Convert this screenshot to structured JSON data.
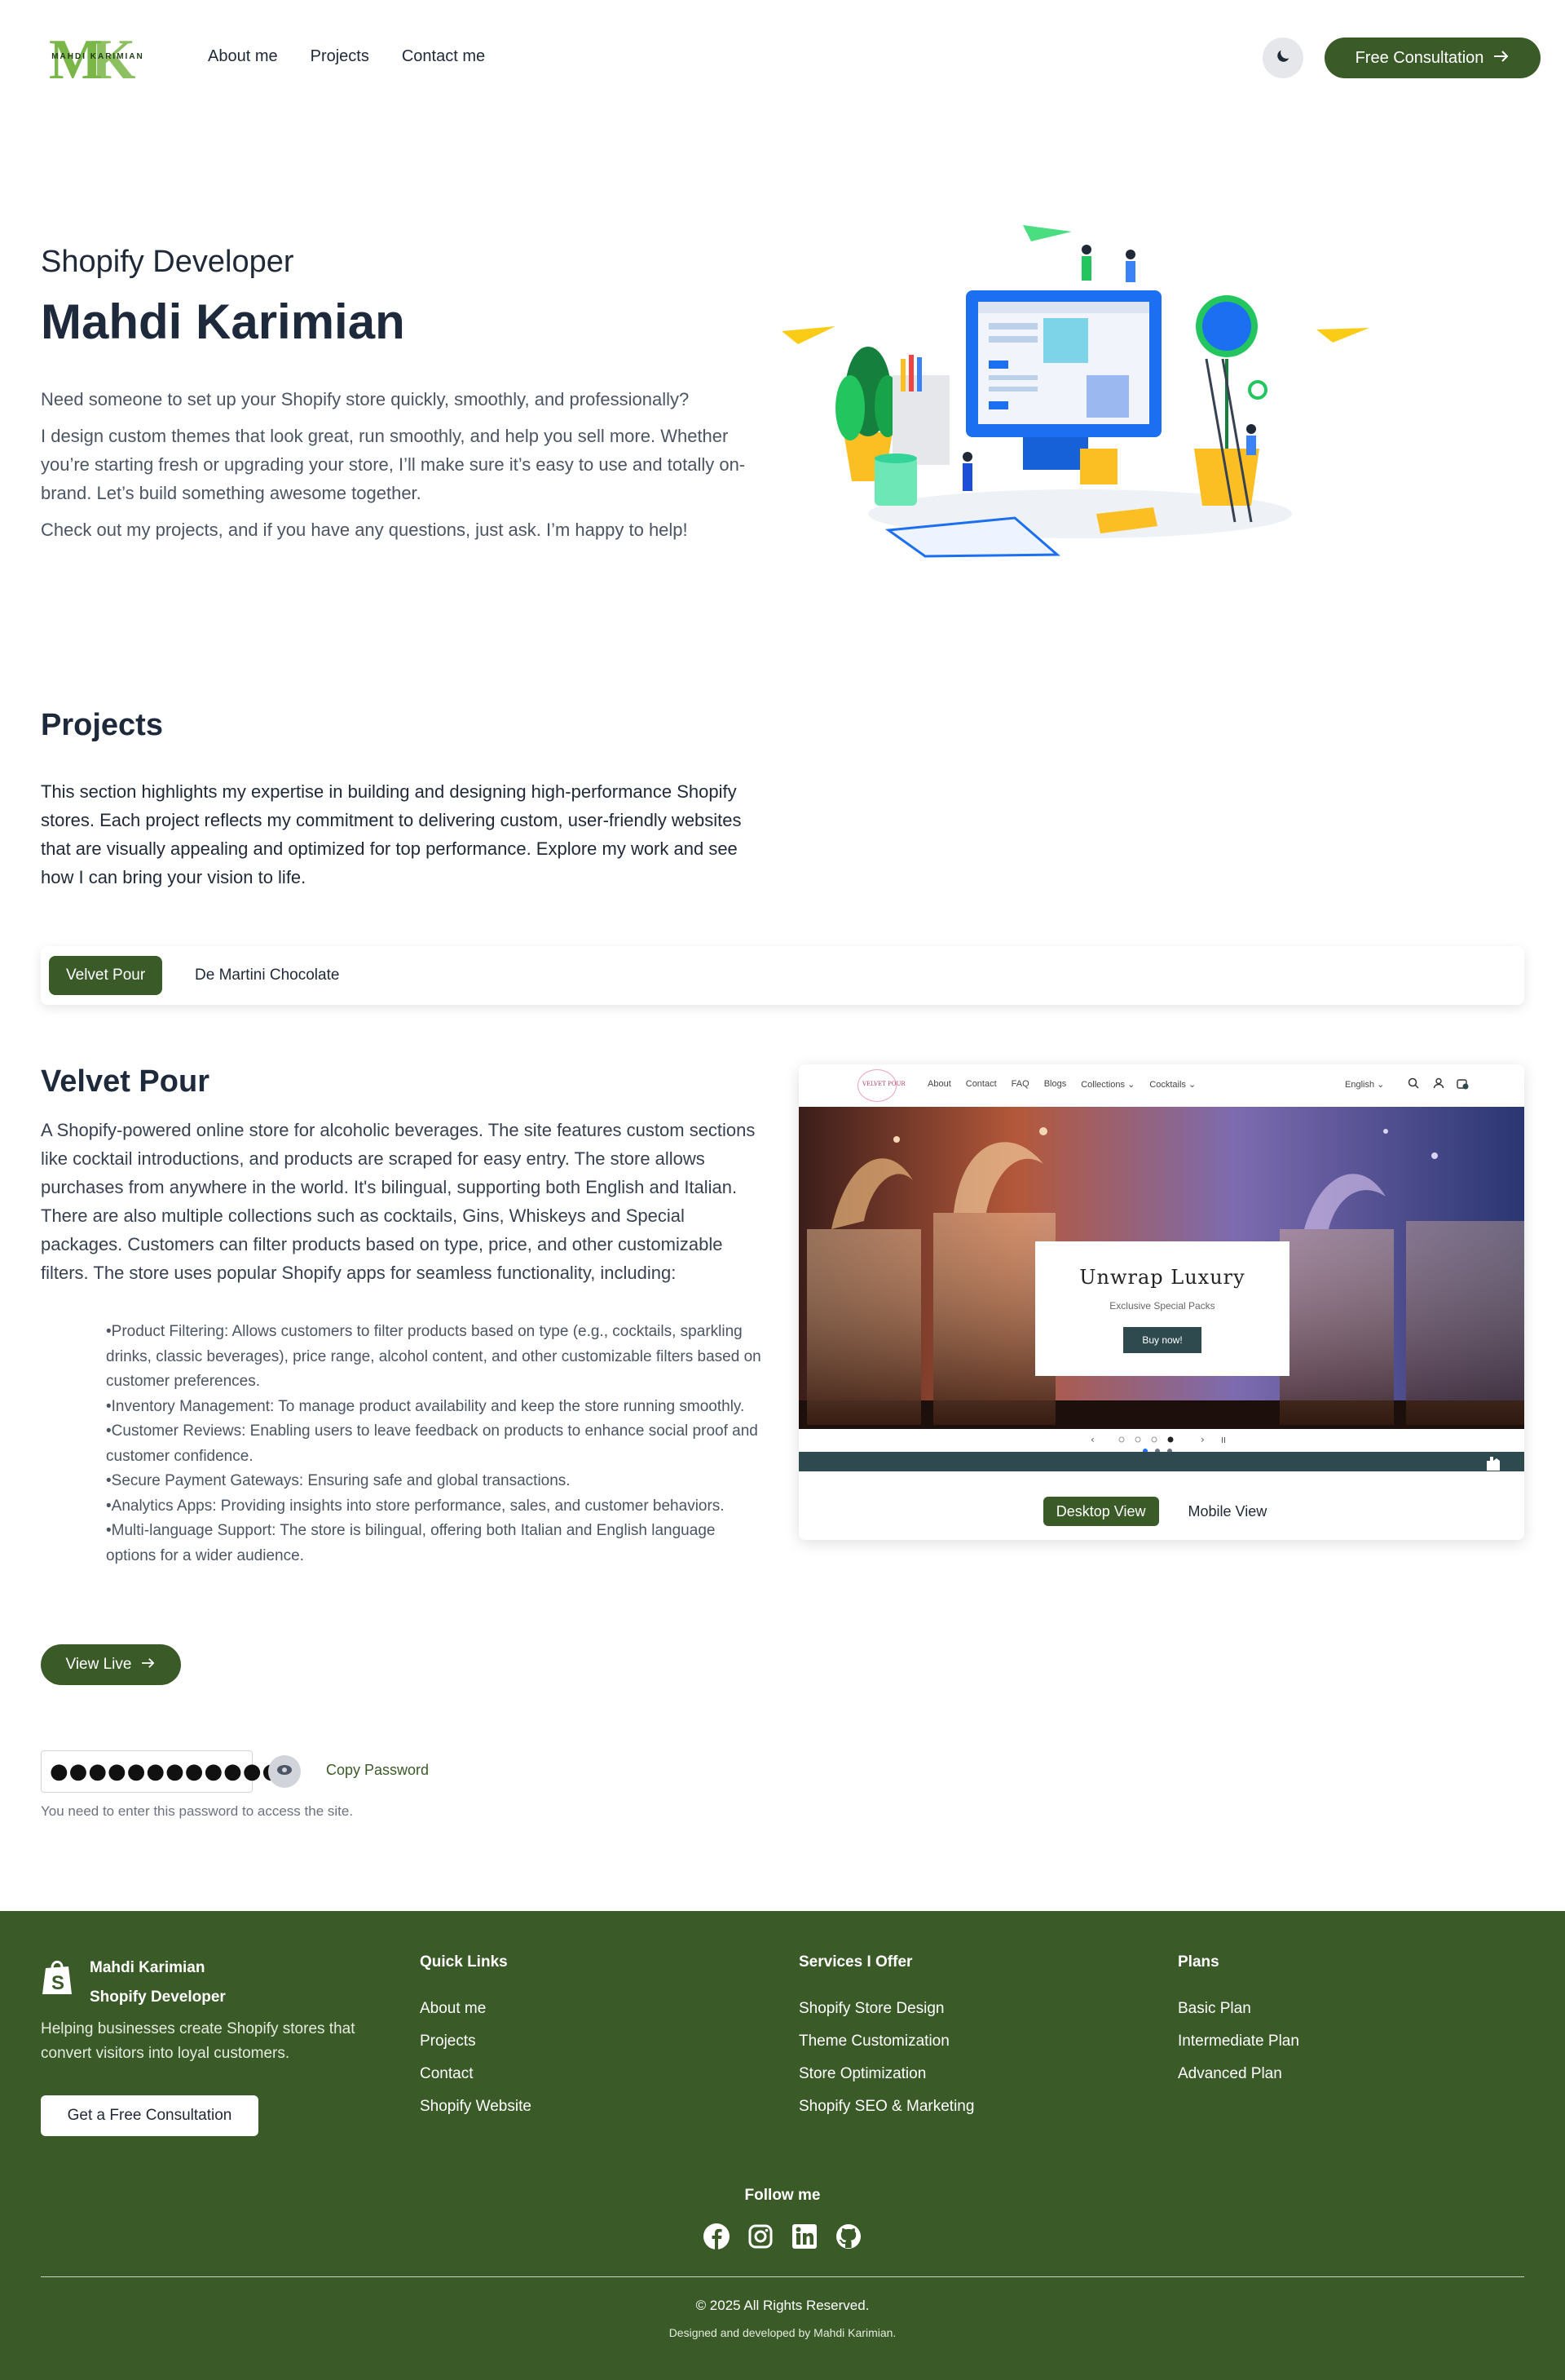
{
  "header": {
    "logo_letters": "MK",
    "logo_name": "MAHDI KARIMIAN",
    "nav": [
      "About me",
      "Projects",
      "Contact me"
    ],
    "theme_icon": "moon-icon",
    "cta_label": "Free Consultation"
  },
  "hero": {
    "subtitle": "Shopify Developer",
    "title": "Mahdi Karimian",
    "paragraphs": [
      "Need someone to set up your Shopify store quickly, smoothly, and professionally?",
      "I design custom themes that look great, run smoothly, and help you sell more. Whether you’re starting fresh or upgrading your store, I’ll make sure it’s easy to use and totally on-brand. Let’s build something awesome together.",
      "Check out my projects, and if you have any questions, just ask. I’m happy to help!"
    ]
  },
  "projects": {
    "title": "Projects",
    "intro": "This section highlights my expertise in building and designing high-performance Shopify stores. Each project reflects my commitment to delivering custom, user-friendly websites that are visually appealing and optimized for top performance. Explore my work and see how I can bring your vision to life.",
    "tabs": [
      "Velvet Pour",
      "De Martini Chocolate"
    ],
    "active_tab": "Velvet Pour"
  },
  "velvet_pour": {
    "title": "Velvet Pour",
    "description": "A Shopify-powered online store for alcoholic beverages. The site features custom sections like cocktail introductions, and products are scraped for easy entry. The store allows purchases from anywhere in the world. It's bilingual, supporting both English and Italian. There are also multiple collections such as cocktails, Gins, Whiskeys and Special packages. Customers can filter products based on type, price, and other customizable filters. The store uses popular Shopify apps for seamless functionality, including:",
    "features": [
      "Product Filtering: Allows customers to filter products based on type (e.g., cocktails, sparkling drinks, classic beverages), price range, alcohol content, and other customizable filters based on customer preferences.",
      "Inventory Management: To manage product availability and keep the store running smoothly.",
      "Customer Reviews: Enabling users to leave feedback on products to enhance social proof and customer confidence.",
      "Secure Payment Gateways: Ensuring safe and global transactions.",
      "Analytics Apps: Providing insights into store performance, sales, and customer behaviors.",
      "Multi-language Support: The store is bilingual, offering both Italian and English language options for a wider audience."
    ],
    "view_live_label": "View Live",
    "password_value": "●●●●●●●●●●●●●",
    "copy_password_label": "Copy Password",
    "password_note": "You need to enter this password to access the site."
  },
  "preview": {
    "brand": "VELVET POUR",
    "nav_links": [
      "About",
      "Contact",
      "FAQ",
      "Blogs",
      "Collections ⌄",
      "Cocktails ⌄"
    ],
    "language": "English ⌄",
    "hero_title": "Unwrap Luxury",
    "hero_subtitle": "Exclusive Special Packs",
    "hero_button": "Buy now!",
    "view_buttons": [
      "Desktop View",
      "Mobile View"
    ],
    "active_view": "Desktop View"
  },
  "footer": {
    "name": "Mahdi Karimian",
    "role": "Shopify Developer",
    "description": "Helping businesses create Shopify stores that convert visitors into loyal customers.",
    "button": "Get a Free Consultation",
    "columns": [
      {
        "heading": "Quick Links",
        "items": [
          "About me",
          "Projects",
          "Contact",
          "Shopify Website"
        ]
      },
      {
        "heading": "Services I Offer",
        "items": [
          "Shopify Store Design",
          "Theme Customization",
          "Store Optimization",
          "Shopify SEO & Marketing"
        ]
      },
      {
        "heading": "Plans",
        "items": [
          "Basic Plan",
          "Intermediate Plan",
          "Advanced Plan"
        ]
      }
    ],
    "follow_label": "Follow me",
    "social_icons": [
      "facebook-icon",
      "instagram-icon",
      "linkedin-icon",
      "github-icon"
    ],
    "copyright": "© 2025 All Rights Reserved.",
    "credit": "Designed and developed by Mahdi Karimian."
  },
  "colors": {
    "brand_green": "#3a5a27",
    "footer_bg": "#3a5a27",
    "heading": "#1e293b",
    "logo_light_green": "#7ab648"
  }
}
